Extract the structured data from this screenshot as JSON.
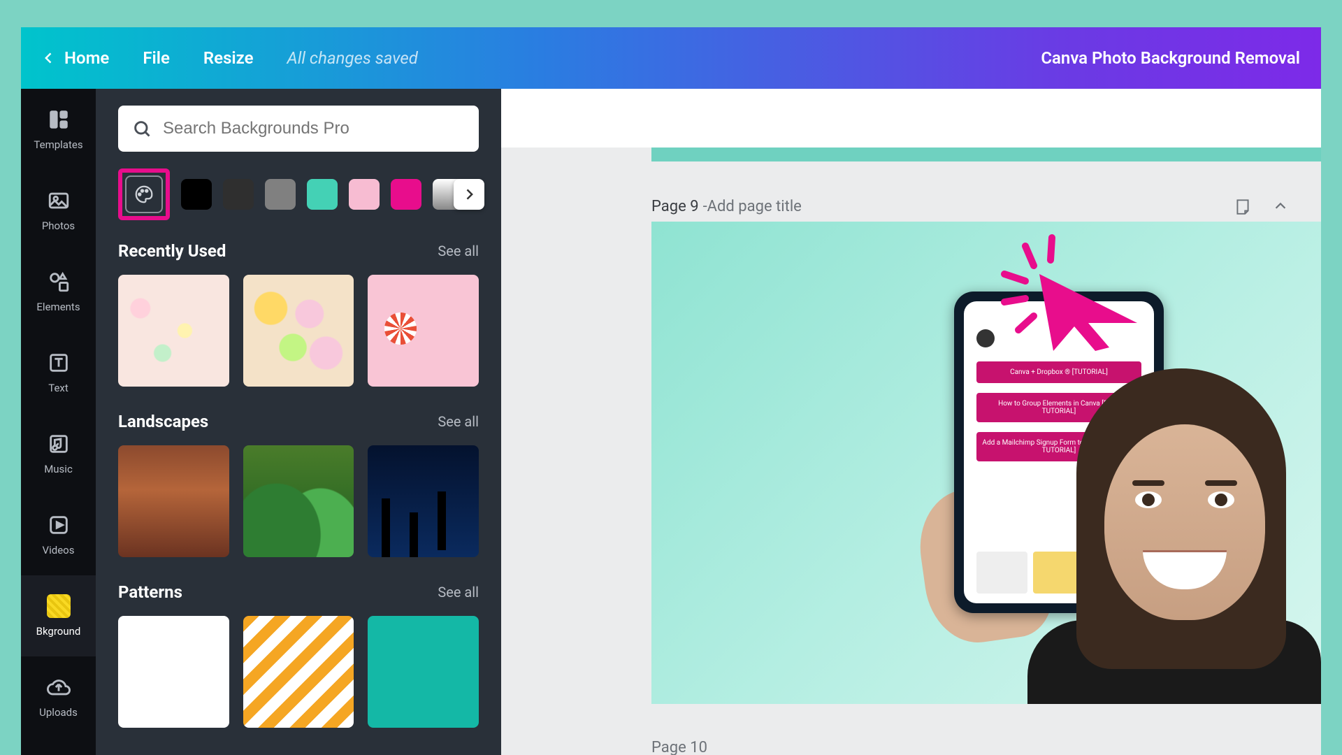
{
  "topbar": {
    "home": "Home",
    "file": "File",
    "resize": "Resize",
    "status": "All changes saved",
    "doc_title": "Canva Photo Background Removal"
  },
  "rail": {
    "templates": "Templates",
    "photos": "Photos",
    "elements": "Elements",
    "text": "Text",
    "music": "Music",
    "videos": "Videos",
    "bkground": "Bkground",
    "uploads": "Uploads"
  },
  "panel": {
    "search_placeholder": "Search Backgrounds Pro",
    "swatches": [
      "#000000",
      "#2f2f2f",
      "#808080",
      "#44d1b5",
      "#f7bcd2",
      "#e80d8c"
    ],
    "gradient_swatch": true,
    "sections": {
      "recent": {
        "title": "Recently Used",
        "seeall": "See all"
      },
      "landscapes": {
        "title": "Landscapes",
        "seeall": "See all"
      },
      "patterns": {
        "title": "Patterns",
        "seeall": "See all"
      }
    }
  },
  "canvas": {
    "page_label": "Page 9",
    "title_placeholder": "Add page title",
    "next_page_label": "Page 10",
    "phone_rows": [
      "Canva + Dropbox ® [TUTORIAL]",
      "How to Group Elements in Canva [FREE TUTORIAL]",
      "Add a Mailchimp Signup Form to Facebook [FREE TUTORIAL]"
    ]
  }
}
